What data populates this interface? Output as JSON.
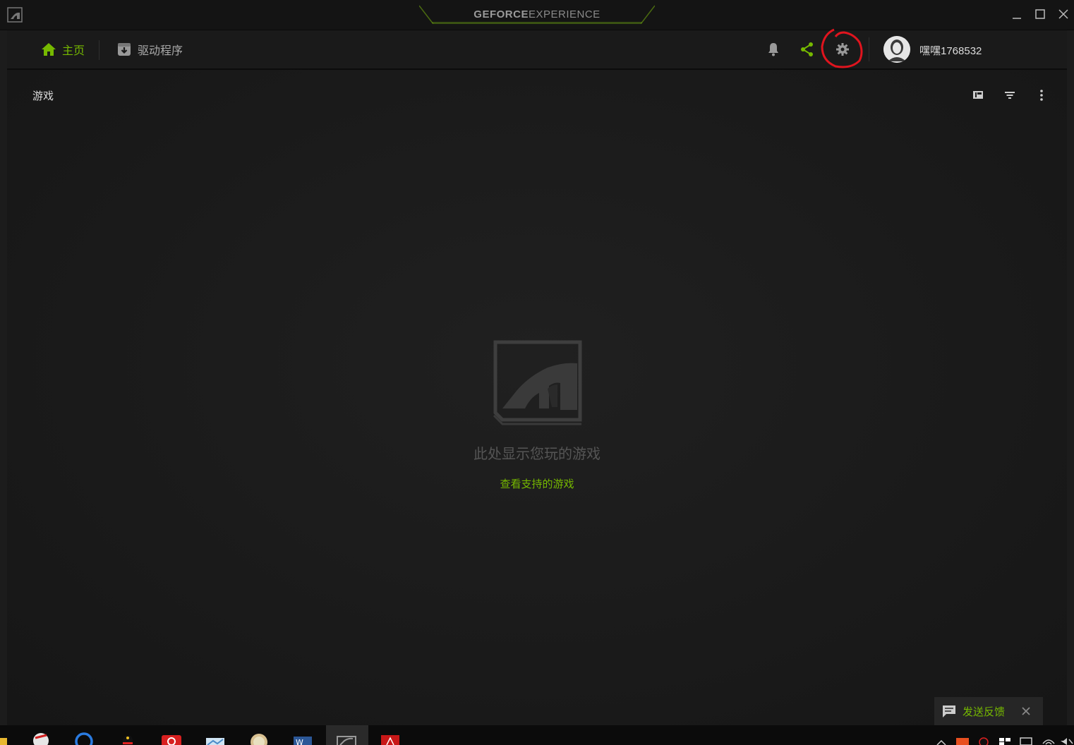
{
  "app": {
    "brand_strong": "GEFORCE",
    "brand_light": "EXPERIENCE"
  },
  "nav": {
    "home_label": "主页",
    "drivers_label": "驱动程序",
    "username": "嘿嘿1768532"
  },
  "content": {
    "section_title": "游戏",
    "empty_message": "此处显示您玩的游戏",
    "empty_link": "查看支持的游戏"
  },
  "feedback": {
    "label": "发送反馈"
  },
  "colors": {
    "accent": "#76b900",
    "annotation": "#e0141e",
    "background": "#1c1c1c"
  }
}
